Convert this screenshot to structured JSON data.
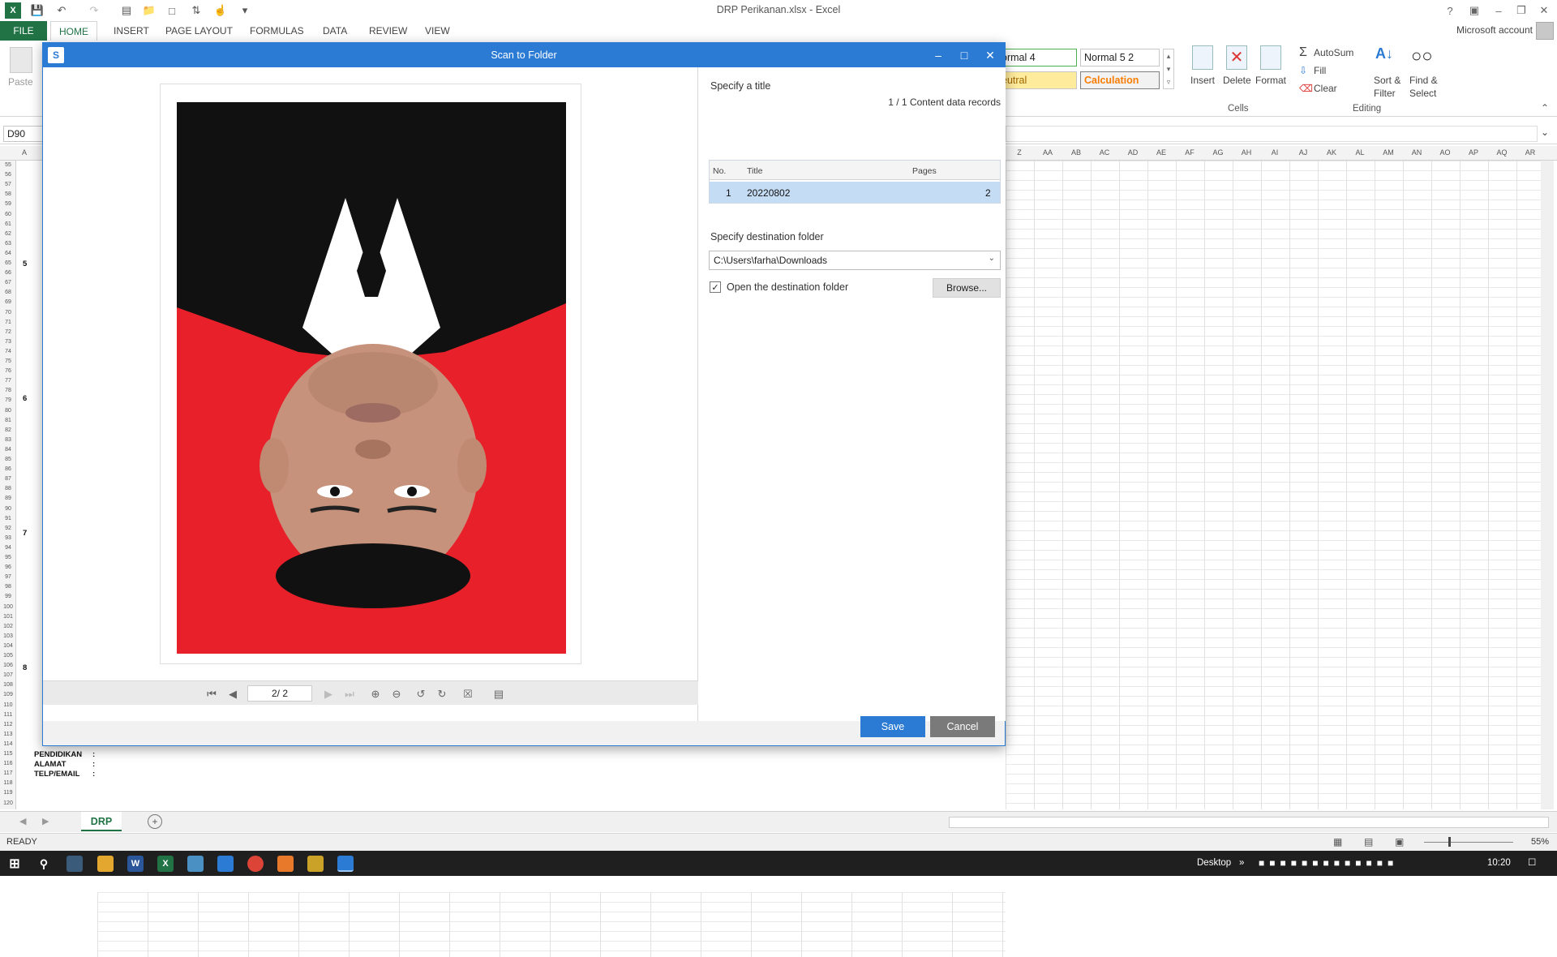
{
  "app": {
    "document_title": "DRP Perikanan.xlsx - Excel",
    "account": "Microsoft account"
  },
  "ribbon": {
    "tabs": [
      "FILE",
      "HOME",
      "INSERT",
      "PAGE LAYOUT",
      "FORMULAS",
      "DATA",
      "REVIEW",
      "VIEW"
    ],
    "paste_label": "Paste",
    "styles": {
      "normal4": "ormal 4",
      "normal52": "Normal 5 2",
      "neutral": "eutral",
      "calculation": "Calculation"
    },
    "cells": {
      "insert": "Insert",
      "delete": "Delete",
      "format": "Format",
      "group": "Cells"
    },
    "editing": {
      "autosum": "AutoSum",
      "fill": "Fill",
      "clear": "Clear",
      "sort_filter": [
        "Sort &",
        "Filter"
      ],
      "find_select": [
        "Find &",
        "Select"
      ],
      "group": "Editing"
    }
  },
  "formula_bar": {
    "name_box": "D90"
  },
  "sheet": {
    "columns": [
      "Z",
      "AA",
      "AB",
      "AC",
      "AD",
      "AE",
      "AF",
      "AG",
      "AH",
      "AI",
      "AJ",
      "AK",
      "AL",
      "AM",
      "AN",
      "AO",
      "AP",
      "AQ",
      "AR"
    ],
    "visible_labels": {
      "pendidikan": "PENDIDIKAN",
      "alamat": "ALAMAT",
      "telp_email": "TELP/EMAIL",
      "colon": ":"
    },
    "section_numbers": [
      "5",
      "6",
      "7",
      "8"
    ],
    "tab_name": "DRP"
  },
  "status": {
    "ready": "READY",
    "zoom": "55%"
  },
  "taskbar": {
    "desktop_label": "Desktop",
    "clock": "10:20"
  },
  "dialog": {
    "title": "Scan to Folder",
    "specify_title_label": "Specify a title",
    "record_counter": "1 /     1 Content data records",
    "table": {
      "headers": {
        "no": "No.",
        "title": "Title",
        "pages": "Pages"
      },
      "rows": [
        {
          "no": "1",
          "title": "20220802",
          "pages": "2"
        }
      ]
    },
    "destination_label": "Specify destination folder",
    "destination_path": "C:\\Users\\farha\\Downloads",
    "open_folder_label": "Open the destination folder",
    "open_folder_checked": true,
    "browse_label": "Browse...",
    "save_label": "Save",
    "cancel_label": "Cancel",
    "page_indicator": "2/  2"
  },
  "colors": {
    "excel_green": "#217346",
    "dialog_blue": "#2b7bd4",
    "photo_red": "#e8202a",
    "photo_black": "#111111"
  }
}
